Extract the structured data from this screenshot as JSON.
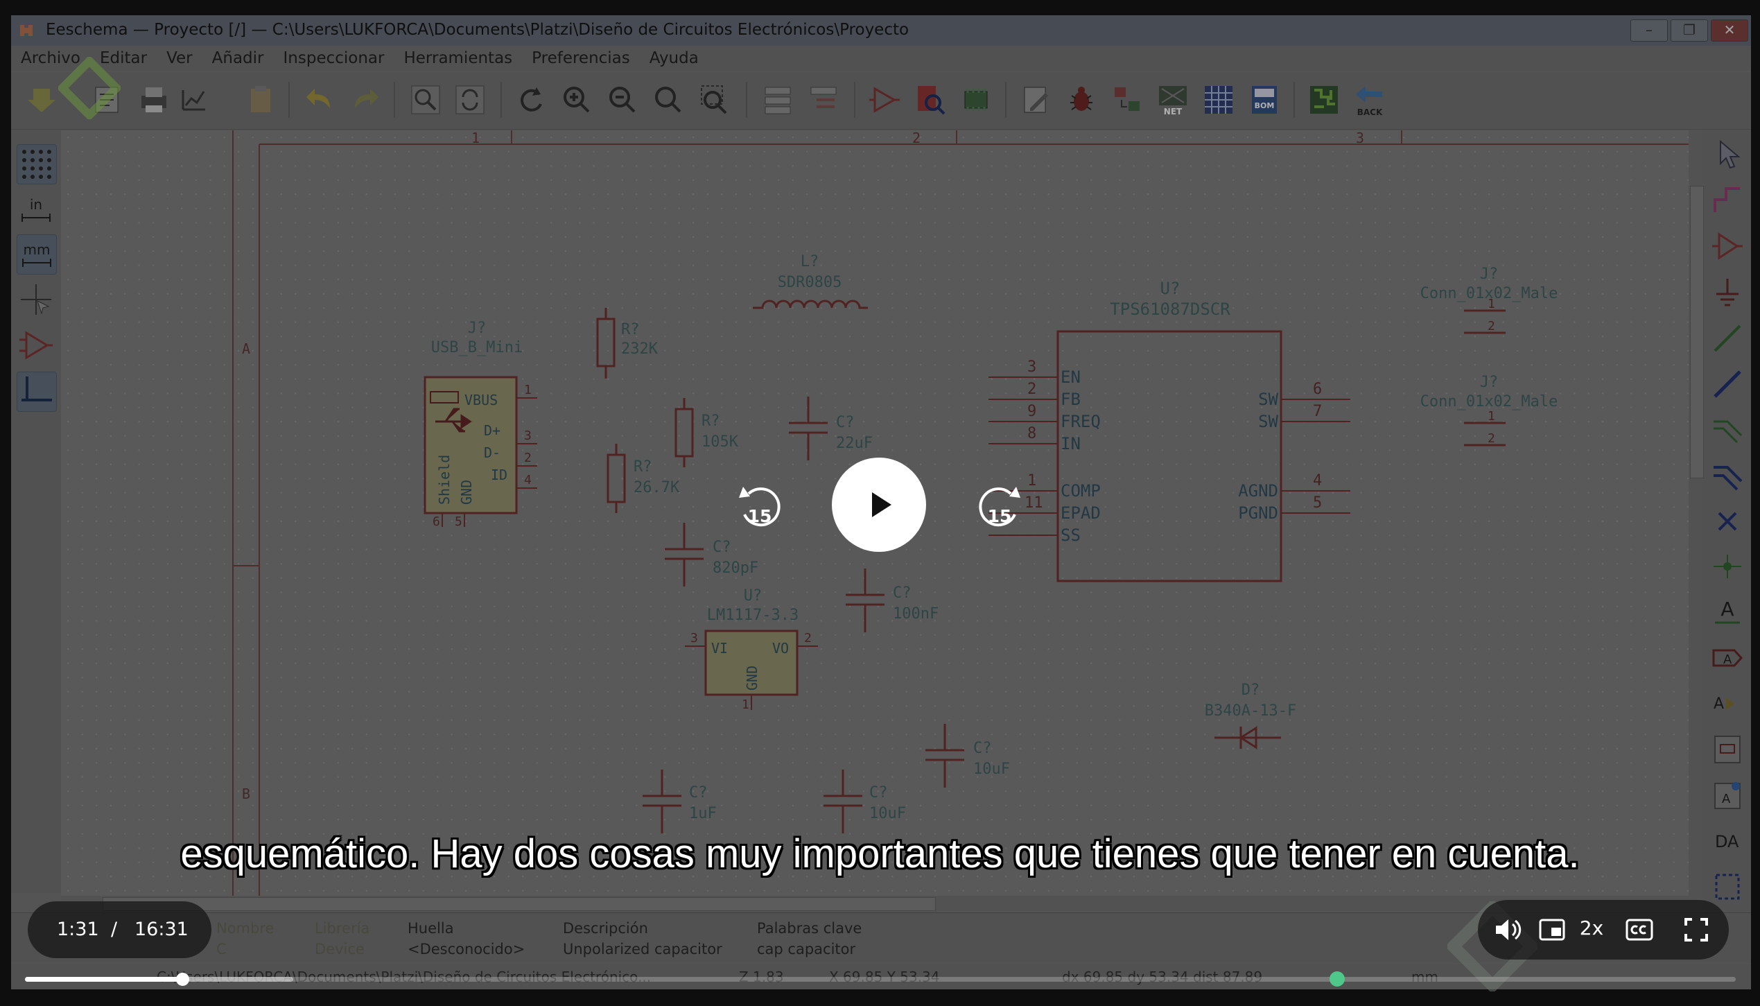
{
  "window": {
    "title": "Eeschema — Proyecto [/] — C:\\Users\\LUKFORCA\\Documents\\Platzi\\Diseño de Circuitos Electrónicos\\Proyecto",
    "controls": [
      "minimize",
      "restore",
      "close"
    ]
  },
  "menu": [
    "Archivo",
    "Editar",
    "Ver",
    "Añadir",
    "Inspeccionar",
    "Herramientas",
    "Preferencias",
    "Ayuda"
  ],
  "toolbar": {
    "icons": [
      "save-icon",
      "page-settings-icon",
      "print-icon",
      "plot-icon",
      "paste-icon",
      "undo-icon",
      "redo-icon",
      "find-icon",
      "find-replace-icon",
      "redraw-icon",
      "zoom-in-icon",
      "zoom-out-icon",
      "zoom-fit-icon",
      "zoom-selection-icon",
      "hierarchy-navigator-icon",
      "leave-sheet-icon",
      "symbol-editor-icon",
      "symbol-browser-icon",
      "footprint-editor-icon",
      "annotate-icon",
      "erc-icon",
      "assign-footprints-icon",
      "netlist-icon",
      "bom-table-icon",
      "bom-icon",
      "pcbnew-icon",
      "back-annotate-icon"
    ],
    "net_label": "NET",
    "bom_label": "BOM",
    "back_label": "BACK"
  },
  "left_toolbar": {
    "in_label": "in",
    "mm_label": "mm",
    "icons": [
      "grid-icon",
      "inches-icon",
      "millimeters-icon",
      "cursor-shape-icon",
      "hidden-pins-icon",
      "wire-angle-icon"
    ]
  },
  "right_toolbar": {
    "icons": [
      "select-icon",
      "highlight-net-icon",
      "add-symbol-icon",
      "add-power-icon",
      "add-wire-icon",
      "add-bus-icon",
      "wire-to-bus-icon",
      "bus-to-bus-icon",
      "no-connect-icon",
      "junction-icon",
      "net-label-icon",
      "global-label-icon",
      "hierarchical-label-icon",
      "hierarchical-sheet-icon",
      "import-sheet-pin-icon",
      "add-text-icon",
      "add-lines-icon"
    ]
  },
  "schematic": {
    "border_cols": [
      "1",
      "2",
      "3"
    ],
    "border_rows": [
      "A",
      "B"
    ],
    "components": {
      "usb": {
        "ref": "J?",
        "value": "USB_B_Mini",
        "pins": [
          "VBUS",
          "D+",
          "D-",
          "ID",
          "Shield",
          "GND"
        ],
        "pin_numbers": [
          "1",
          "3",
          "2",
          "4",
          "6",
          "5"
        ]
      },
      "inductor": {
        "ref": "L?",
        "value": "SDR0805"
      },
      "r1": {
        "ref": "R?",
        "value": "232K"
      },
      "r2": {
        "ref": "R?",
        "value": "105K"
      },
      "r3": {
        "ref": "R?",
        "value": "26.7K"
      },
      "c_22": {
        "ref": "C?",
        "value": "22uF"
      },
      "c_820": {
        "ref": "C?",
        "value": "820pF"
      },
      "c_100": {
        "ref": "C?",
        "value": "100nF"
      },
      "c_10a": {
        "ref": "C?",
        "value": "10uF"
      },
      "c_1": {
        "ref": "C?",
        "value": "1uF"
      },
      "c_10b": {
        "ref": "C?",
        "value": "10uF"
      },
      "ldo": {
        "ref": "U?",
        "value": "LM1117-3.3",
        "pins": [
          "VI",
          "VO",
          "GND"
        ],
        "pin_numbers": [
          "3",
          "2",
          "1"
        ]
      },
      "boost": {
        "ref": "U?",
        "value": "TPS61087DSCR",
        "left_pins": [
          {
            "num": "3",
            "name": "EN"
          },
          {
            "num": "2",
            "name": "FB"
          },
          {
            "num": "9",
            "name": "FREQ"
          },
          {
            "num": "8",
            "name": "IN"
          },
          {
            "num": "1",
            "name": "COMP"
          },
          {
            "num": "11",
            "name": "EPAD"
          },
          {
            "num": "",
            "name": "SS"
          }
        ],
        "right_pins": [
          {
            "num": "6",
            "name": "SW"
          },
          {
            "num": "7",
            "name": "SW"
          },
          {
            "num": "4",
            "name": "AGND"
          },
          {
            "num": "5",
            "name": "PGND"
          }
        ]
      },
      "conn1": {
        "ref": "J?",
        "value": "Conn_01x02_Male",
        "pins": [
          "1",
          "2"
        ]
      },
      "conn2": {
        "ref": "J?",
        "value": "Conn_01x02_Male",
        "pins": [
          "1",
          "2"
        ]
      },
      "diode": {
        "ref": "D?",
        "value": "B340A-13-F"
      }
    }
  },
  "message_panel": {
    "col1": {
      "header": "Nombre",
      "value": "C"
    },
    "col2": {
      "header": "Librería",
      "value": "Device"
    },
    "col3": {
      "header": "Huella",
      "value": "<Desconocido>"
    },
    "col4": {
      "header": "Descripción",
      "value": "Unpolarized capacitor"
    },
    "col5": {
      "header": "Palabras clave",
      "value": "cap capacitor"
    }
  },
  "statusbar": {
    "file": "C:\\Users\\LUKFORCA\\Documents\\Platzi\\Diseño de Circuitos Electrónico...",
    "zoom": "Z 1.83",
    "xy": "X 69.85  Y 53.34",
    "delta": "dx 69.85  dy 53.34  dist 87.89",
    "units": "mm"
  },
  "player": {
    "current_time": "1:31",
    "separator": "/",
    "duration": "16:31",
    "skip_back": "15",
    "skip_forward": "15",
    "speed": "2x",
    "subtitle": "esquemático. Hay dos cosas muy importantes que tienes que tener en cuenta.",
    "progress_fraction": 0.0918,
    "buffered_fraction": 0.157,
    "colors": {
      "accent": "#4fc78a",
      "overlay": "#141414"
    }
  }
}
